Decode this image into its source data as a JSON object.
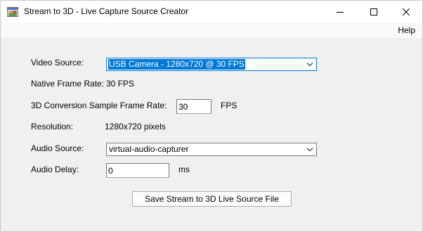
{
  "window": {
    "title": "Stream to 3D - Live Capture Source Creator",
    "icon": "app-window-icon",
    "controls": [
      "minimize-icon",
      "maximize-icon",
      "close-icon"
    ]
  },
  "menu": {
    "help": "Help"
  },
  "form": {
    "video_source_label": "Video Source:",
    "video_source_value": "USB Camera - 1280x720 @ 30 FPS",
    "native_frame_rate_label": "Native Frame Rate:",
    "native_frame_rate_value": "30 FPS",
    "sample_rate_label": "3D Conversion Sample Frame Rate:",
    "sample_rate_value": "30",
    "sample_rate_unit": "FPS",
    "resolution_label": "Resolution:",
    "resolution_value": "1280x720 pixels",
    "audio_source_label": "Audio Source:",
    "audio_source_value": "virtual-audio-capturer",
    "audio_delay_label": "Audio Delay:",
    "audio_delay_value": "0",
    "audio_delay_unit": "ms",
    "save_button": "Save Stream to 3D Live Source File"
  },
  "colors": {
    "selection": "#0078d7",
    "background": "#f0f0f0"
  }
}
